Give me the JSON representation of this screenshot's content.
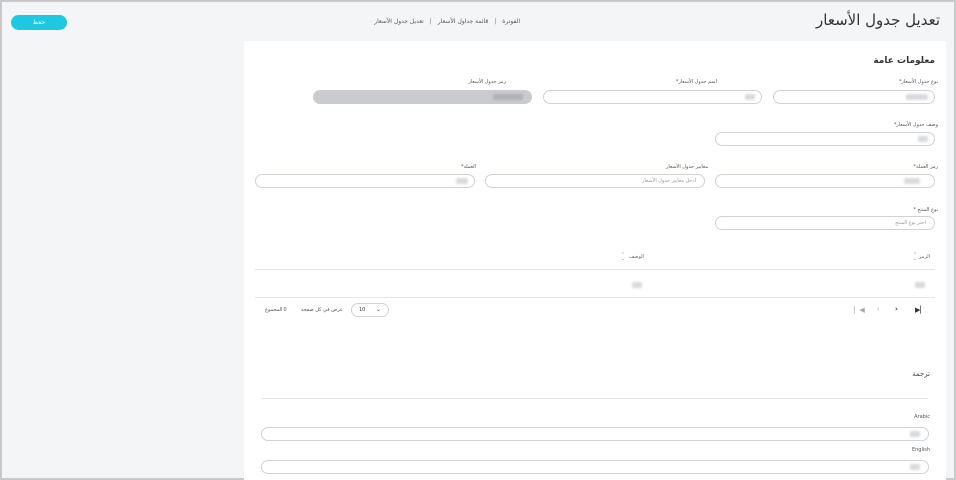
{
  "header": {
    "title": "تعديل جدول الأسعار",
    "save_label": "حفظ",
    "breadcrumb": [
      "الفوترة",
      "قائمة جداول الأسعار",
      "تعديل جدول الأسعار"
    ]
  },
  "general": {
    "section_title": "معلومات عامة",
    "fields": {
      "price_list_type": {
        "label": "نوع جدول الأسعار*"
      },
      "price_list_name": {
        "label": "اسم جدول الأسعار*"
      },
      "price_list_code": {
        "label": "رمز جدول الأسعار"
      },
      "price_list_desc": {
        "label": "وصف جدول الأسعار*"
      },
      "currency_code": {
        "label": "رمز العملة*"
      },
      "price_list_params": {
        "label": "معايير جدول الأسعار",
        "placeholder": "أدخل معايير جدول الأسعار"
      },
      "currency": {
        "label": "العملة*"
      },
      "product_type": {
        "label": "نوع المنتج *",
        "placeholder": "اختر نوع المنتج"
      }
    }
  },
  "table": {
    "columns": [
      "الرمز",
      "الوصف"
    ],
    "per_page_value": "10",
    "per_page_label": "عرض في كل صفحة",
    "total_label": "المجموع",
    "total_value": "0"
  },
  "translation": {
    "section_title": "ترجمة",
    "languages": [
      "Arabic",
      "English"
    ]
  },
  "colors": {
    "accent": "#1ec8e3",
    "disabled_fill": "#c9cbcf"
  },
  "icons": [
    "sort-icon",
    "first-page-icon",
    "prev-page-icon",
    "next-page-icon",
    "last-page-icon",
    "chevron-down-icon"
  ]
}
